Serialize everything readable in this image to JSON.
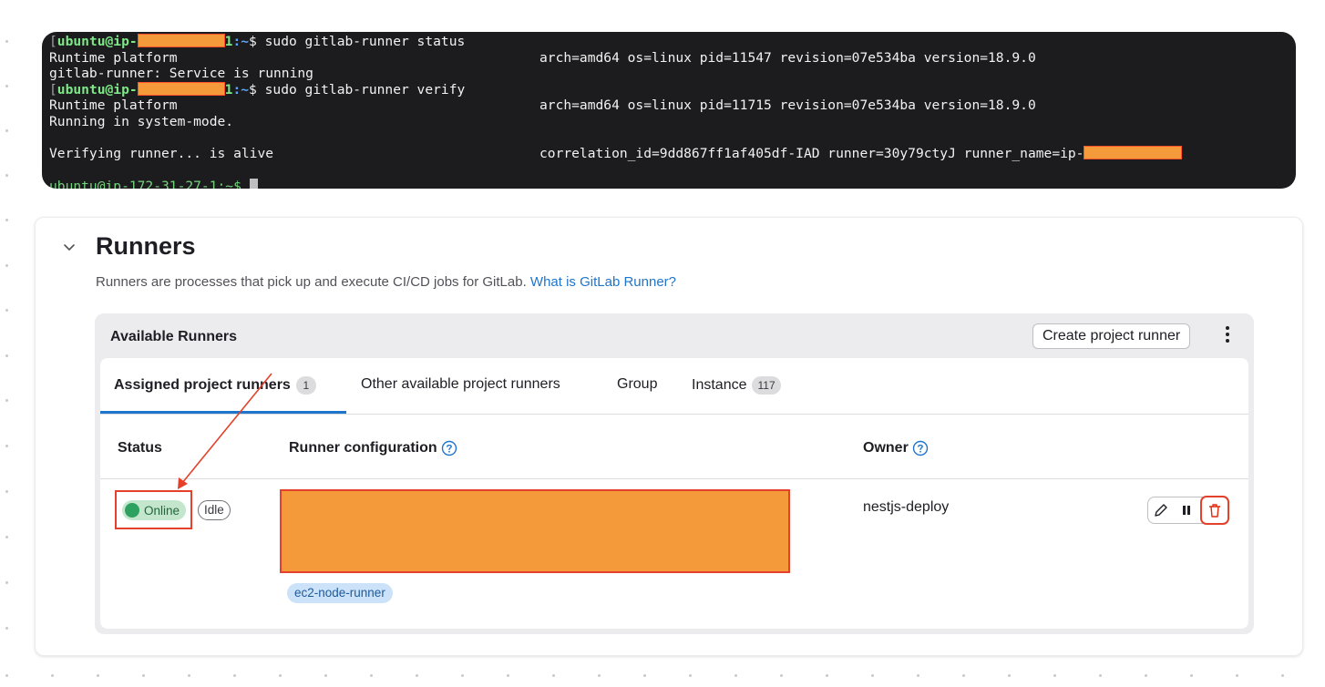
{
  "terminal": {
    "lines": [
      {
        "user": "ubuntu@ip-",
        "suffix": "1",
        "path": ":~",
        "command": "$ sudo gitlab-runner status"
      },
      {
        "left": "Runtime platform",
        "right": "arch=amd64 os=linux pid=11547 revision=07e534ba version=18.9.0"
      },
      {
        "left": "gitlab-runner: Service is running"
      },
      {
        "user": "ubuntu@ip-",
        "suffix": "1",
        "path": ":~",
        "command": "$ sudo gitlab-runner verify"
      },
      {
        "left": "Runtime platform",
        "right": "arch=amd64 os=linux pid=11715 revision=07e534ba version=18.9.0"
      },
      {
        "left": "Running in system-mode."
      },
      {
        "left": ""
      },
      {
        "left": "Verifying runner... is alive",
        "right": "correlation_id=9dd867ff1af405df-IAD runner=30y79ctyJ runner_name=ip-"
      }
    ],
    "partial_line": "ubuntu@ip-172-31-27-1:~$ "
  },
  "runners": {
    "title": "Runners",
    "description": "Runners are processes that pick up and execute CI/CD jobs for GitLab.",
    "help_link": "What is GitLab Runner?",
    "panel_title": "Available Runners",
    "create_button": "Create project runner",
    "tabs": [
      {
        "label": "Assigned project runners",
        "count": "1"
      },
      {
        "label": "Other available project runners"
      },
      {
        "label": "Group"
      },
      {
        "label": "Instance",
        "count": "117"
      }
    ],
    "columns": {
      "status": "Status",
      "config": "Runner configuration",
      "owner": "Owner"
    },
    "row": {
      "status": "Online",
      "state": "Idle",
      "tag": "ec2-node-runner",
      "owner": "nestjs-deploy"
    }
  },
  "colors": {
    "online_dot": "#2da160",
    "link": "#1f75cb",
    "redaction": "#f59a3a",
    "annotation": "#e3412c"
  }
}
